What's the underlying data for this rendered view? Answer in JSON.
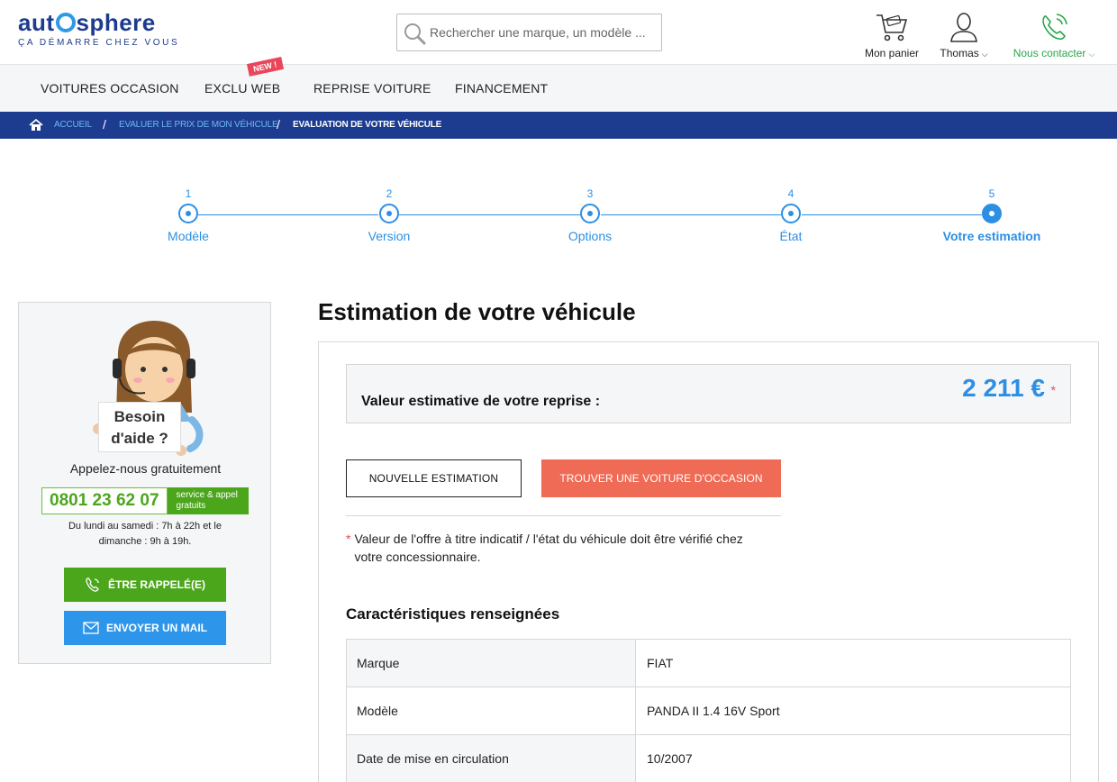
{
  "header": {
    "logo_word_left": "aut",
    "logo_word_right": "sphere",
    "tagline": "ÇA DÉMARRE CHEZ VOUS",
    "search_placeholder": "Rechercher une marque, un modèle ...",
    "cart_label": "Mon panier",
    "user_label": "Thomas",
    "contact_label": "Nous contacter",
    "chevron": "⌵"
  },
  "nav": {
    "items": [
      "VOITURES OCCASION",
      "EXCLU WEB",
      "REPRISE VOITURE",
      "FINANCEMENT"
    ],
    "new_badge": "NEW !"
  },
  "breadcrumb": {
    "items": [
      "ACCUEIL",
      "EVALUER LE PRIX DE MON VÉHICULE",
      "EVALUATION DE VOTRE VÉHICULE"
    ],
    "separator": "/"
  },
  "stepper": {
    "steps": [
      {
        "num": "1",
        "label": "Modèle"
      },
      {
        "num": "2",
        "label": "Version"
      },
      {
        "num": "3",
        "label": "Options"
      },
      {
        "num": "4",
        "label": "État"
      },
      {
        "num": "5",
        "label": "Votre estimation"
      }
    ],
    "active_step": 5
  },
  "help": {
    "sign_line1": "Besoin",
    "sign_line2": "d'aide ?",
    "title": "Appelez-nous gratuitement",
    "phone": "0801 23 62 07",
    "phone_tag": "service & appel gratuits",
    "hours": "Du lundi au samedi : 7h à 22h et le dimanche : 9h à 19h.",
    "call_button": "ÊTRE RAPPELÉ(E)",
    "mail_button": "ENVOYER UN MAIL"
  },
  "main": {
    "title": "Estimation de votre véhicule",
    "estimate_label": "Valeur estimative de votre reprise :",
    "estimate_value": "2 211 €",
    "estimate_star": "*",
    "new_estimate_button": "NOUVELLE ESTIMATION",
    "find_car_button": "TROUVER UNE VOITURE D'OCCASION",
    "disclaimer_star": "*",
    "disclaimer": "Valeur de l'offre à titre indicatif / l'état du véhicule doit être vérifié chez votre concessionnaire.",
    "specs_title": "Caractéristiques renseignées",
    "specs": [
      {
        "label": "Marque",
        "value": "FIAT"
      },
      {
        "label": "Modèle",
        "value": "PANDA II 1.4 16V Sport"
      },
      {
        "label": "Date de mise en circulation",
        "value": "10/2007"
      }
    ]
  },
  "colors": {
    "brand_navy": "#1d3c8f",
    "accent_blue": "#2d8fe4",
    "green": "#4ca61c",
    "coral": "#ef6b55",
    "red": "#e8475b"
  }
}
